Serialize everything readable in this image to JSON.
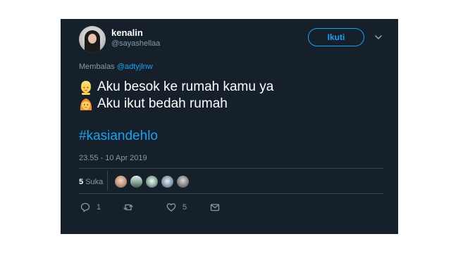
{
  "author": {
    "name": "kenalin",
    "handle": "@sayashellaa",
    "follow_label": "Ikuti"
  },
  "reply_to": {
    "prefix": "Membalas",
    "mention": "@adtyjlnw"
  },
  "tweet": {
    "lines": [
      {
        "emoji": "man-blond-emoji",
        "text": "Aku besok ke rumah kamu ya"
      },
      {
        "emoji": "woman-emoji",
        "text": "Aku ikut bedah rumah"
      }
    ],
    "hashtag": "#kasiandehlo",
    "timestamp": "23.55 - 10 Apr 2019"
  },
  "likes": {
    "count": "5",
    "label": "Suka",
    "avatars": [
      "avatar",
      "avatar",
      "avatar",
      "avatar",
      "avatar"
    ]
  },
  "actions": {
    "reply": {
      "icon": "reply-icon",
      "count": "1"
    },
    "retweet": {
      "icon": "retweet-icon",
      "count": ""
    },
    "like": {
      "icon": "heart-icon",
      "count": "5"
    },
    "dm": {
      "icon": "mail-icon",
      "count": ""
    }
  },
  "colors": {
    "background": "#15202b",
    "accent": "#1da1f2",
    "secondary_text": "#8899a6",
    "divider": "#38444d"
  }
}
